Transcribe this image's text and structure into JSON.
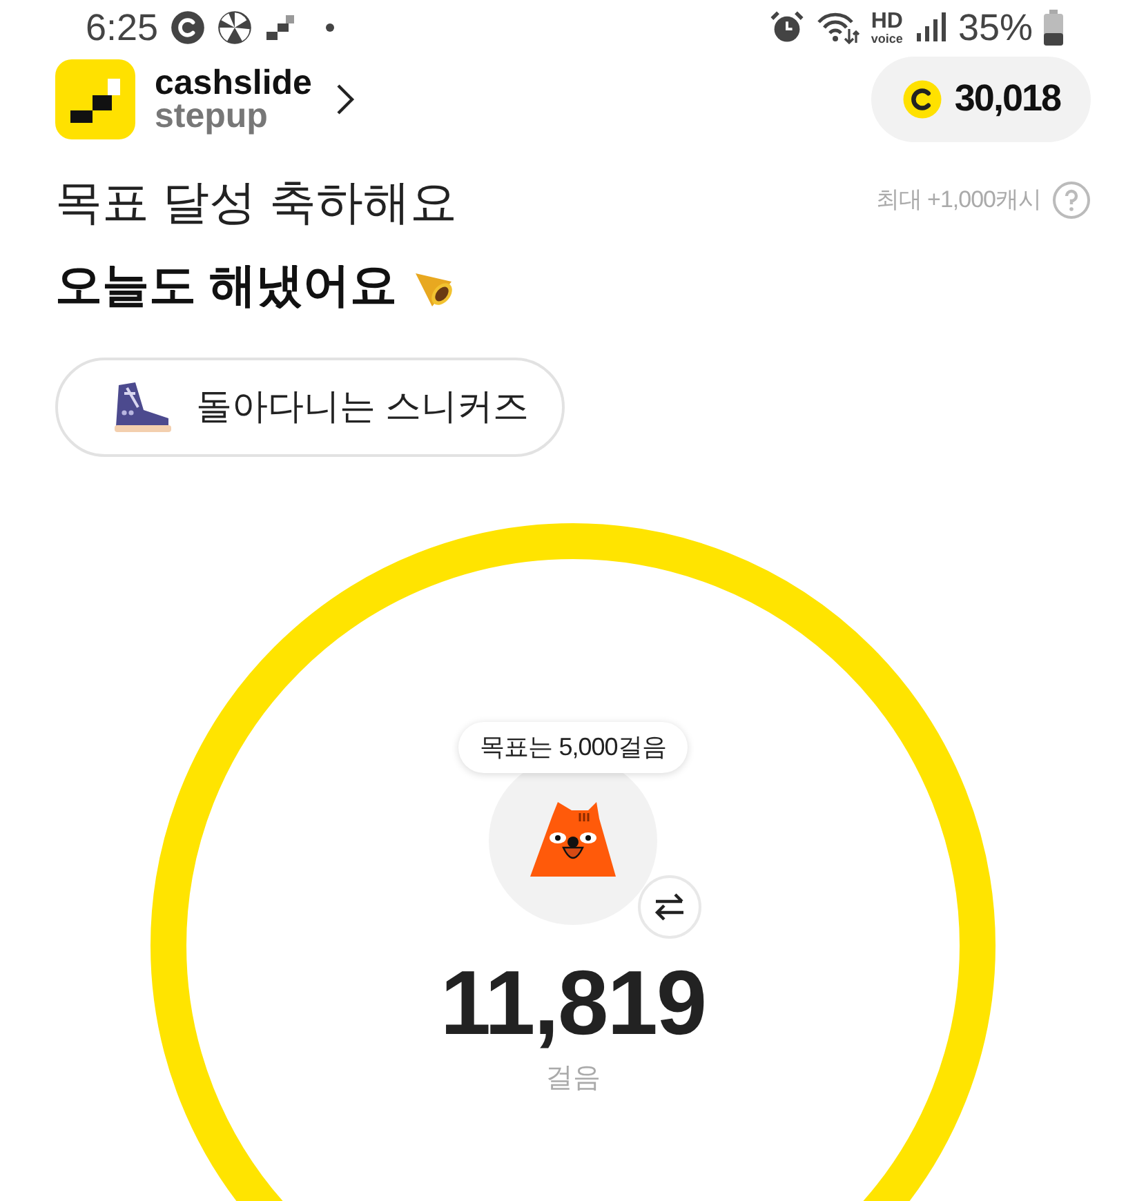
{
  "status_bar": {
    "time": "6:25",
    "hd": "HD",
    "voice": "voice",
    "battery": "35%"
  },
  "header": {
    "brand": "cashslide",
    "product": "stepup",
    "coins": "30,018"
  },
  "headline": "목표 달성 축하해요",
  "reward_note": "최대 +1,000캐시",
  "subheadline": "오늘도 해냈어요",
  "badge": "돌아다니는 스니커즈",
  "goal_tooltip": "목표는 5,000걸음",
  "steps": "11,819",
  "steps_unit": "걸음"
}
